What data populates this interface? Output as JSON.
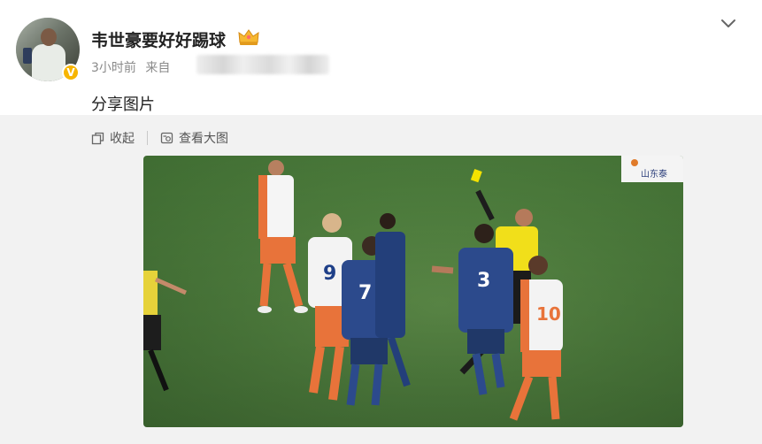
{
  "post": {
    "username": "韦世豪要好好踢球",
    "time": "3小时前",
    "source_prefix": "来自",
    "text": "分享图片"
  },
  "actions": {
    "collapse_label": "收起",
    "view_large_label": "查看大图"
  },
  "photo": {
    "sponsor_text": "山东泰",
    "players": [
      {
        "number": "9",
        "team": "white-orange"
      },
      {
        "number": "7",
        "team": "blue"
      },
      {
        "number": "3",
        "team": "blue"
      },
      {
        "number": "10",
        "team": "white-orange"
      }
    ]
  },
  "colors": {
    "badge": "#f7b500",
    "username": "#222222",
    "meta": "#8a8a8a",
    "pitch": "#4f7f3e",
    "blue_kit": "#2c4a8c",
    "orange_kit": "#e8733a",
    "card": "#f4e200"
  },
  "icons": {
    "verified": "verified-badge-icon",
    "crown": "crown-icon",
    "chevron": "chevron-down-icon",
    "collapse": "collapse-icon",
    "view_large": "view-large-icon"
  }
}
